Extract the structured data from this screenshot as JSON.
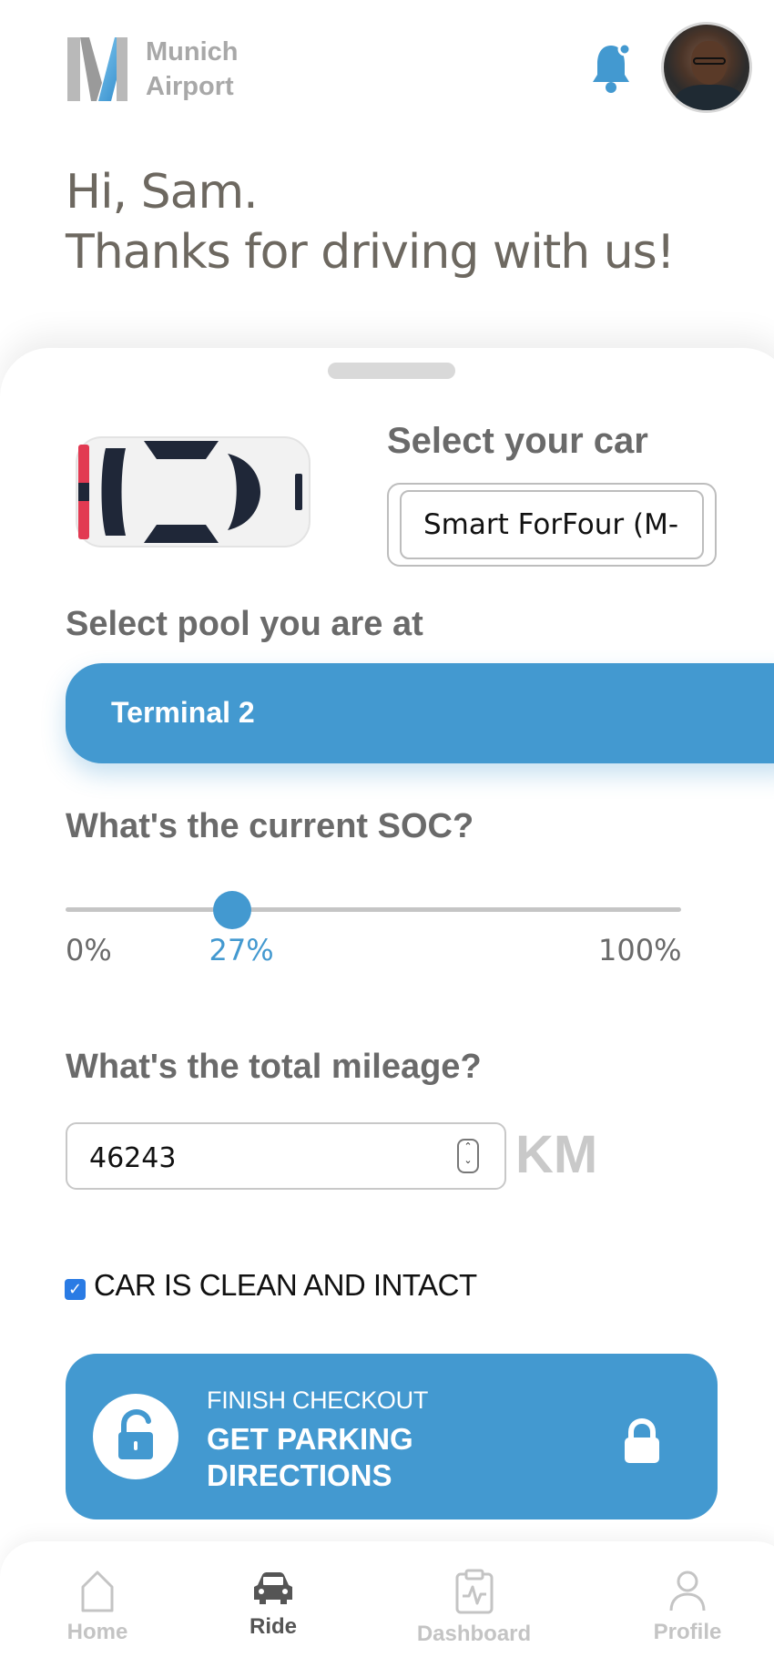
{
  "header": {
    "logo_line1": "Munich",
    "logo_line2": "Airport"
  },
  "greeting": {
    "line1": "Hi, Sam.",
    "line2": "Thanks for driving with us!"
  },
  "car": {
    "label": "Select your car",
    "selected": "Smart ForFour (M-"
  },
  "pool": {
    "label": "Select pool you are at",
    "selected": "Terminal 2"
  },
  "soc": {
    "label": "What's the current SOC?",
    "min_label": "0%",
    "value_label": "27%",
    "max_label": "100%",
    "value": 27
  },
  "mileage": {
    "label": "What's the total mileage?",
    "value": "46243",
    "unit": "KM"
  },
  "condition": {
    "checked": true,
    "label": "CAR IS CLEAN AND INTACT"
  },
  "cta": {
    "small": "FINISH CHECKOUT",
    "big": "GET PARKING DIRECTIONS"
  },
  "nav": {
    "items": [
      {
        "label": "Home",
        "icon": "home-icon",
        "active": false
      },
      {
        "label": "Ride",
        "icon": "car-icon",
        "active": true
      },
      {
        "label": "Dashboard",
        "icon": "clipboard-icon",
        "active": false
      },
      {
        "label": "Profile",
        "icon": "user-icon",
        "active": false
      }
    ]
  },
  "colors": {
    "accent": "#4399d0",
    "text_muted": "#6a6a6a",
    "checkbox": "#2a7be4"
  }
}
